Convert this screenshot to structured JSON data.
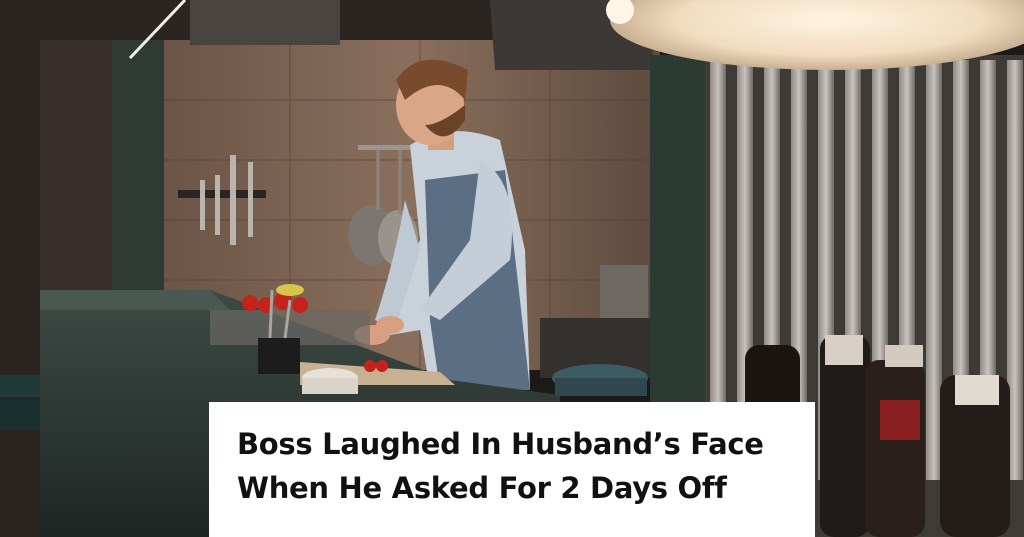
{
  "headline": {
    "line1": "Boss Laughed In Husband’s Face",
    "line2": "When He Asked For 2 Days Off"
  }
}
